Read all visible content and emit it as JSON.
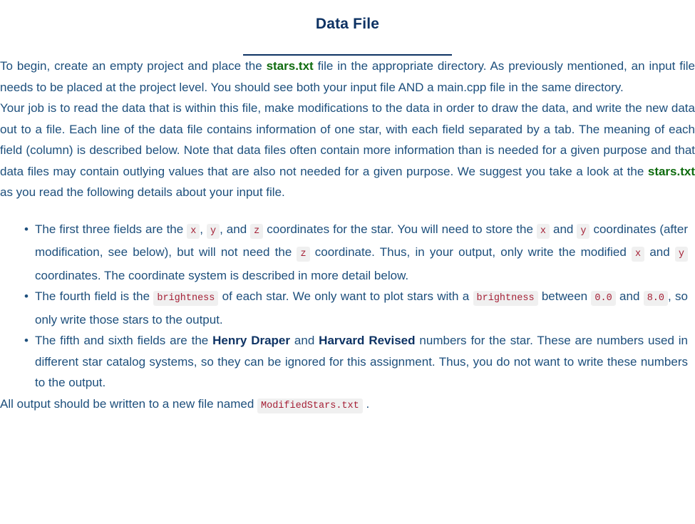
{
  "document": {
    "title": "Data File",
    "intro_paragraph": {
      "part1": "To begin, create an empty project and place the ",
      "file1": "stars.txt",
      "part2": " file in the appropriate directory. As previously mentioned, an input file needs to be placed at the project level. You should see both your input file AND a main.cpp file in the same directory."
    },
    "job_paragraph": {
      "part1": "Your job is to read the data that is within this file, make modifications to the data in order to draw the data, and write the new data out to a file. Each line of the data file contains information of one star, with each field separated by a tab. The meaning of each field (column) is described below. Note that data files often contain more information than is needed for a given purpose and that data files may contain outlying values that are also not needed for a given purpose. We suggest you take a look at the ",
      "file1": "stars.txt",
      "part2": " as you read the following details about your input file."
    },
    "field_list": [
      {
        "t1": "The first three fields are the ",
        "c1": "x",
        "t2": ", ",
        "c2": "y",
        "t3": ", and ",
        "c3": "z",
        "t4": " coordinates for the star. You will need to store the ",
        "c4": "x",
        "t5": " and ",
        "c5": "y",
        "t6": " coordinates (after modification, see below), but will not need the ",
        "c6": "z",
        "t7": " coordinate. Thus, in your output, only write the modified ",
        "c7": "x",
        "t8": " and ",
        "c8": "y",
        "t9": " coordinates. The coordinate system is described in more detail below."
      },
      {
        "t1": "The fourth field is the ",
        "c1": "brightness",
        "t2": " of each star. We only want to plot stars with a ",
        "c2": "brightness",
        "t3": " between ",
        "c3": "0.0",
        "t4": " and ",
        "c4": "8.0",
        "t5": ", so only write those stars to the output."
      },
      {
        "t1": "The fifth and sixth fields are the ",
        "b1": "Henry Draper",
        "t2": " and ",
        "b2": "Harvard Revised",
        "t3": " numbers for the star. These are numbers used in different star catalog systems, so they can be ignored for this assignment. Thus, you do not want to write these numbers to the output."
      }
    ],
    "output_paragraph": {
      "part1": "All output should be written to a new file named ",
      "code1": "ModifiedStars.txt",
      "part2": " ."
    },
    "bullet_glyph": "•",
    "colors": {
      "body_text": "#1d4f7c",
      "title": "#0d3263",
      "file_reference": "#0e6b0e",
      "code_text": "#a52036",
      "code_background": "#f0f0f0",
      "page_background": "#ffffff"
    }
  }
}
